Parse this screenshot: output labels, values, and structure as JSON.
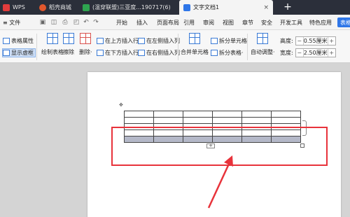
{
  "tabs": {
    "wps": "WPS",
    "daoke": "稻壳商城",
    "sheet": "(温穿联盟)三亚度...190717(6)",
    "doc": "文字文档1",
    "close": "×",
    "new_tab": "+"
  },
  "menu": {
    "file": "≡ 文件",
    "items": [
      "开始",
      "插入",
      "页面布局",
      "引用",
      "审阅",
      "视图",
      "章节",
      "安全",
      "开发工具",
      "特色应用",
      "表格"
    ],
    "active": "表格"
  },
  "ribbon": {
    "table_props": "表格属性",
    "show_gridlines": "显示虚框",
    "draw_table": "绘制表格",
    "erase": "擦除",
    "delete": "删除·",
    "insert_above": "在上方插入行",
    "insert_below": "在下方插入行",
    "insert_left": "在左侧插入列",
    "insert_right": "在右侧插入列",
    "merge_cells": "合并单元格",
    "split_cells": "拆分单元格",
    "split_table": "拆分表格·",
    "auto_adjust": "自动调整·",
    "height_label": "高度:",
    "height_value": "0.55厘米",
    "width_label": "宽度:",
    "width_value": "2.50厘米",
    "minus": "−",
    "plus": "+"
  },
  "document": {
    "move_handle": "✥",
    "add_row": "+",
    "table_rows": 5,
    "table_cols": 6
  },
  "colors": {
    "highlight": "#e8333b",
    "accent": "#1f6fe5",
    "selected_row": "#b4b8c8"
  }
}
